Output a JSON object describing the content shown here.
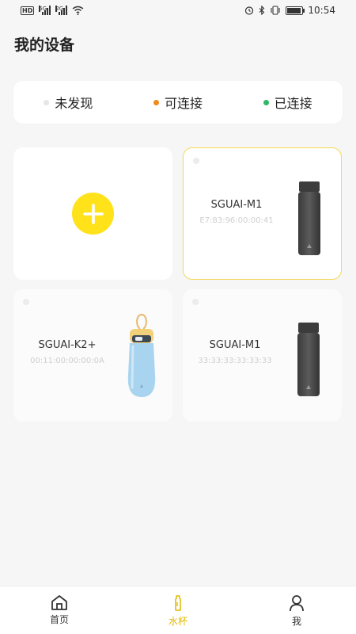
{
  "status_bar": {
    "left_badge": "HD",
    "signal1_label": "5G",
    "signal2_label": "2G",
    "time": "10:54",
    "icons": [
      "alarm-icon",
      "bluetooth-icon",
      "vibrate-icon",
      "battery-icon"
    ]
  },
  "page": {
    "title": "我的设备"
  },
  "legend": {
    "items": [
      {
        "label": "未发现",
        "color": "#e6e6e6"
      },
      {
        "label": "可连接",
        "color": "#f08a1c"
      },
      {
        "label": "已连接",
        "color": "#2db866"
      }
    ]
  },
  "devices": [
    {
      "name": "SGUAI-M1",
      "mac": "E7:83:96:00:00:41",
      "selected": true
    },
    {
      "name": "SGUAI-K2+",
      "mac": "00:11:00:00:00:0A",
      "selected": false
    },
    {
      "name": "SGUAI-M1",
      "mac": "33:33:33:33:33:33",
      "selected": false
    }
  ],
  "tabs": [
    {
      "label": "首页",
      "icon": "home-icon",
      "active": false
    },
    {
      "label": "水杯",
      "icon": "cup-icon",
      "active": true
    },
    {
      "label": "我",
      "icon": "user-icon",
      "active": false
    }
  ],
  "colors": {
    "accent": "#ffe21a",
    "tab_active": "#e2b900",
    "selected_border": "#f3d957"
  }
}
